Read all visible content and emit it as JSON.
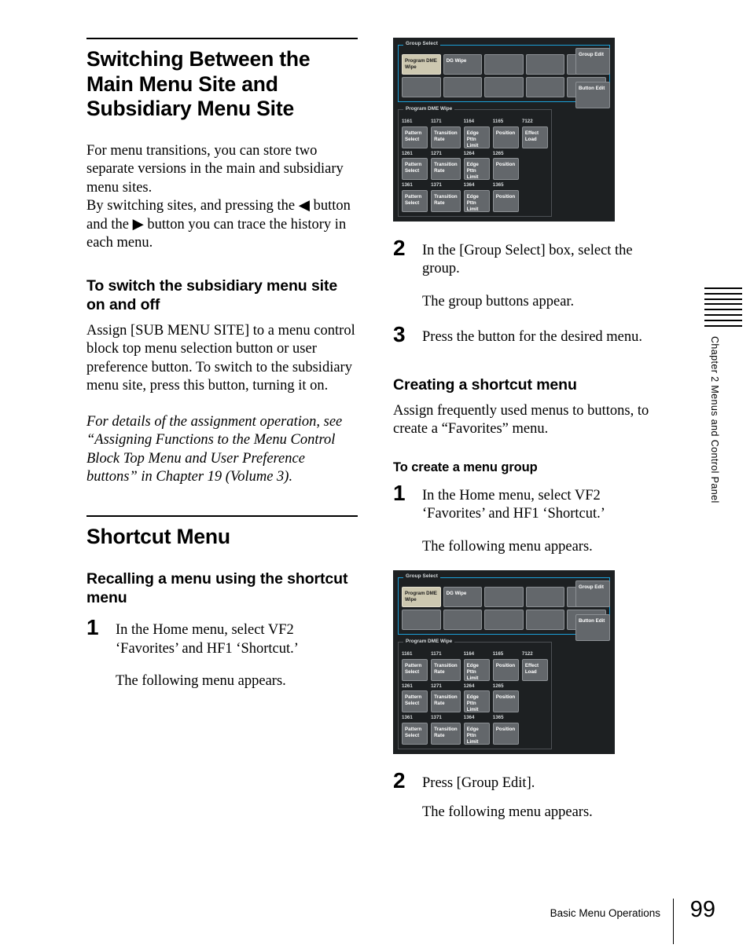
{
  "left_column": {
    "section_title": "Switching Between the Main Menu Site and Subsidiary Menu Site",
    "intro_paragraph": "For menu transitions, you can store two separate versions in the main and subsidiary menu sites.",
    "intro_paragraph2_pre": "By switching sites, and pressing the ",
    "intro_paragraph2_mid": " button and the ",
    "intro_paragraph2_post": " button you can trace the history in each menu.",
    "left_arrow": "◀",
    "right_arrow": "▶",
    "subsection_title": "To switch the subsidiary menu site on and off",
    "subsection_paragraph": "Assign [SUB MENU SITE] to a menu control block top menu selection button or user preference button. To switch to the subsidiary menu site, press this button, turning it on.",
    "reference_note": "For details of the assignment operation, see “Assigning Functions to the Menu Control Block Top Menu and User Preference buttons” in Chapter 19 (Volume 3).",
    "section2_title": "Shortcut Menu",
    "section2_sub_title": "Recalling a menu using the shortcut menu",
    "step1_num": "1",
    "step1_text": "In the Home menu, select VF2 ‘Favorites’ and HF1 ‘Shortcut.’",
    "step1_note": "The following menu appears."
  },
  "right_column": {
    "step2_num": "2",
    "step2_text": "In the [Group Select] box, select the group.",
    "step2_note": "The group buttons appear.",
    "step3_num": "3",
    "step3_text": "Press the button for the desired menu.",
    "section_title": "Creating a shortcut menu",
    "section_paragraph": "Assign frequently used menus to buttons, to create a “Favorites” menu.",
    "subsection_title": "To create a menu group",
    "step1_num": "1",
    "step1_text": "In the Home menu, select VF2 ‘Favorites’ and HF1 ‘Shortcut.’",
    "step1_note": "The following menu appears.",
    "step2b_num": "2",
    "step2b_text": "Press [Group Edit].",
    "step2b_note": "The following menu appears."
  },
  "panel": {
    "group_select_title": "Group Select",
    "group_edit_label": "Group Edit",
    "group_buttons_row1": [
      "Program DME Wipe",
      "DG Wipe",
      "",
      "",
      ""
    ],
    "group_buttons_row2": [
      "",
      "",
      "",
      "",
      ""
    ],
    "selected_group_index": 0,
    "program_box_title": "Program DME Wipe",
    "button_edit_label": "Button Edit",
    "menu_grid": [
      [
        {
          "code": "1161",
          "label": "Pattern Select"
        },
        {
          "code": "1171",
          "label": "Transition Rate"
        },
        {
          "code": "1164",
          "label": "Edge Pttn Limit"
        },
        {
          "code": "1165",
          "label": "Position"
        },
        {
          "code": "7122",
          "label": "Effect Load"
        }
      ],
      [
        {
          "code": "1261",
          "label": "Pattern Select"
        },
        {
          "code": "1271",
          "label": "Transition Rate"
        },
        {
          "code": "1264",
          "label": "Edge Pttn Limit"
        },
        {
          "code": "1265",
          "label": "Position"
        },
        {
          "code": "",
          "label": ""
        }
      ],
      [
        {
          "code": "1361",
          "label": "Pattern Select"
        },
        {
          "code": "1371",
          "label": "Transition Rate"
        },
        {
          "code": "1364",
          "label": "Edge Pttn Limit"
        },
        {
          "code": "1365",
          "label": "Position"
        },
        {
          "code": "",
          "label": ""
        }
      ]
    ],
    "colors": {
      "background": "#1d2022",
      "button": "#63676b",
      "button_selected": "#cdc8b0",
      "accent_border": "#1c9fd8",
      "text": "#ffffff"
    }
  },
  "chapter_tab": {
    "text": "Chapter 2  Menus and Control Panel",
    "line_count": 8
  },
  "footer": {
    "running_head": "Basic Menu Operations",
    "page_number": "99"
  }
}
